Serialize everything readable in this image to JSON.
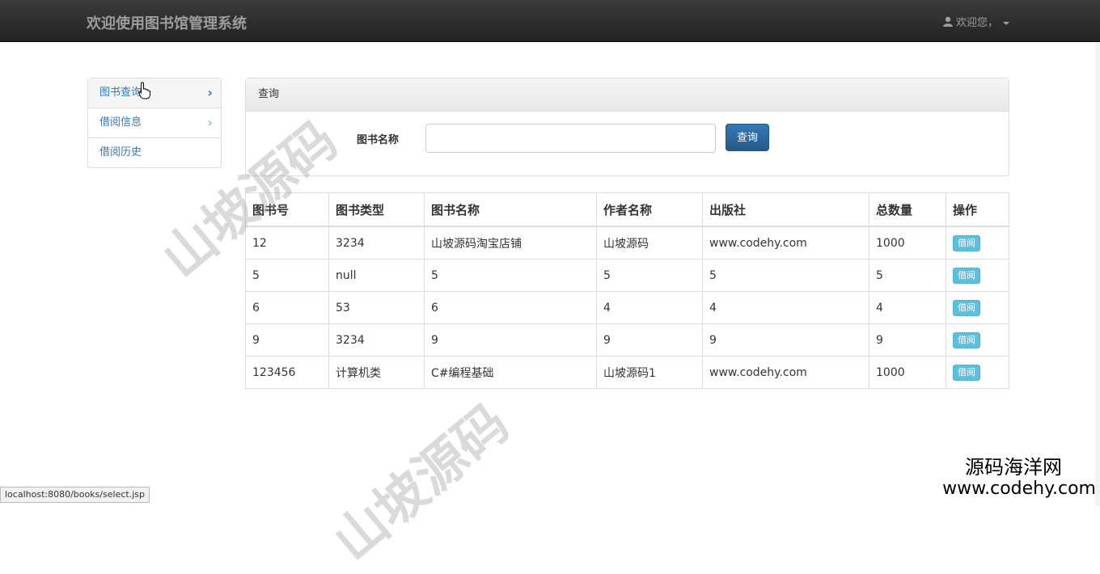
{
  "navbar": {
    "title": "欢迎使用图书馆管理系统",
    "user_label": "欢迎您，"
  },
  "sidebar": {
    "items": [
      {
        "label": "图书查询"
      },
      {
        "label": "借阅信息"
      },
      {
        "label": "借阅历史"
      }
    ]
  },
  "search": {
    "panel_title": "查询",
    "field_label": "图书名称",
    "value": "",
    "button_label": "查询"
  },
  "table": {
    "headers": [
      "图书号",
      "图书类型",
      "图书名称",
      "作者名称",
      "出版社",
      "总数量",
      "操作"
    ],
    "action_label": "借阅",
    "rows": [
      [
        "12",
        "3234",
        "山坡源码淘宝店铺",
        "山坡源码",
        "www.codehy.com",
        "1000"
      ],
      [
        "5",
        "null",
        "5",
        "5",
        "5",
        "5"
      ],
      [
        "6",
        "53",
        "6",
        "4",
        "4",
        "4"
      ],
      [
        "9",
        "3234",
        "9",
        "9",
        "9",
        "9"
      ],
      [
        "123456",
        "计算机类",
        "C#编程基础",
        "山坡源码1",
        "www.codehy.com",
        "1000"
      ]
    ]
  },
  "statusbar": {
    "url": "localhost:8080/books/select.jsp"
  },
  "watermarks": {
    "main": "山坡源码",
    "second": "山坡源码",
    "corner_line1": "源码海洋网",
    "corner_line2": "www.codehy.com"
  }
}
